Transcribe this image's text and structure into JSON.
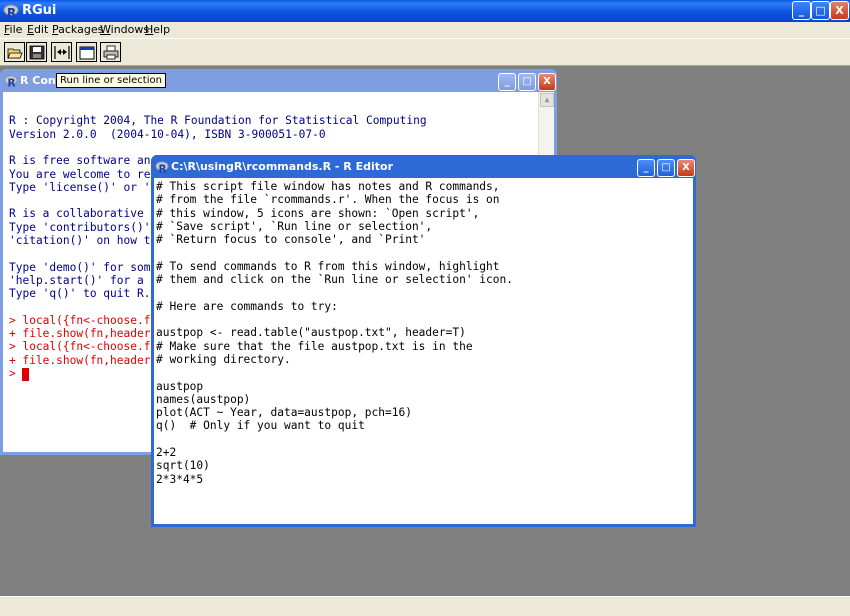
{
  "app": {
    "title": "RGui",
    "controls": {
      "minimize": "_",
      "maximize": "□",
      "close": "X"
    }
  },
  "menu": {
    "items": [
      "File",
      "Edit",
      "Packages",
      "Windows",
      "Help"
    ]
  },
  "toolbar": {
    "buttons": [
      {
        "name": "open-script",
        "icon": "folder-open-icon"
      },
      {
        "name": "save-script",
        "icon": "floppy-disk-icon"
      },
      {
        "name": "run-line-or-selection",
        "icon": "run-arrows-icon"
      },
      {
        "name": "return-focus-to-console",
        "icon": "console-window-icon"
      },
      {
        "name": "print",
        "icon": "printer-icon"
      }
    ],
    "tooltip": "Run line or selection"
  },
  "console": {
    "title": "R Cons",
    "lines": [
      {
        "text": "",
        "color": "blue"
      },
      {
        "text": "R : Copyright 2004, The R Foundation for Statistical Computing",
        "color": "blue"
      },
      {
        "text": "Version 2.0.0  (2004-10-04), ISBN 3-900051-07-0",
        "color": "blue"
      },
      {
        "text": "",
        "color": "blue"
      },
      {
        "text": "R is free software and",
        "color": "blue"
      },
      {
        "text": "You are welcome to re",
        "color": "blue"
      },
      {
        "text": "Type 'license()' or 'l",
        "color": "blue"
      },
      {
        "text": "",
        "color": "blue"
      },
      {
        "text": "R is a collaborative p",
        "color": "blue"
      },
      {
        "text": "Type 'contributors()'",
        "color": "blue"
      },
      {
        "text": "'citation()' on how to",
        "color": "blue"
      },
      {
        "text": "",
        "color": "blue"
      },
      {
        "text": "Type 'demo()' for some",
        "color": "blue"
      },
      {
        "text": "'help.start()' for a H",
        "color": "blue"
      },
      {
        "text": "Type 'q()' to quit R.",
        "color": "blue"
      },
      {
        "text": "",
        "color": "blue"
      },
      {
        "text": "> local({fn<-choose.fi",
        "color": "red"
      },
      {
        "text": "+ file.show(fn,header=",
        "color": "red"
      },
      {
        "text": "> local({fn<-choose.fi",
        "color": "red"
      },
      {
        "text": "+ file.show(fn,header=",
        "color": "red"
      },
      {
        "text": ">",
        "color": "red"
      }
    ]
  },
  "editor": {
    "title": "C:\\R\\usingR\\rcommands.R - R Editor",
    "lines": [
      "# This script file window has notes and R commands,",
      "# from the file `rcommands.r'. When the focus is on",
      "# this window, 5 icons are shown: `Open script',",
      "# `Save script', `Run line or selection',",
      "# `Return focus to console', and `Print'",
      "",
      "# To send commands to R from this window, highlight",
      "# them and click on the `Run line or selection' icon.",
      "",
      "# Here are commands to try:",
      "",
      "austpop <- read.table(\"austpop.txt\", header=T)",
      "# Make sure that the file austpop.txt is in the",
      "# working directory.",
      "",
      "austpop",
      "names(austpop)",
      "plot(ACT ~ Year, data=austpop, pch=16)",
      "q()  # Only if you want to quit",
      "",
      "2+2",
      "sqrt(10)",
      "2*3*4*5"
    ]
  },
  "colors": {
    "title_blue": "#0a58e8",
    "console_text": "#00008b",
    "console_input": "#e00000",
    "workspace": "#808080",
    "chrome": "#ece9d8"
  }
}
